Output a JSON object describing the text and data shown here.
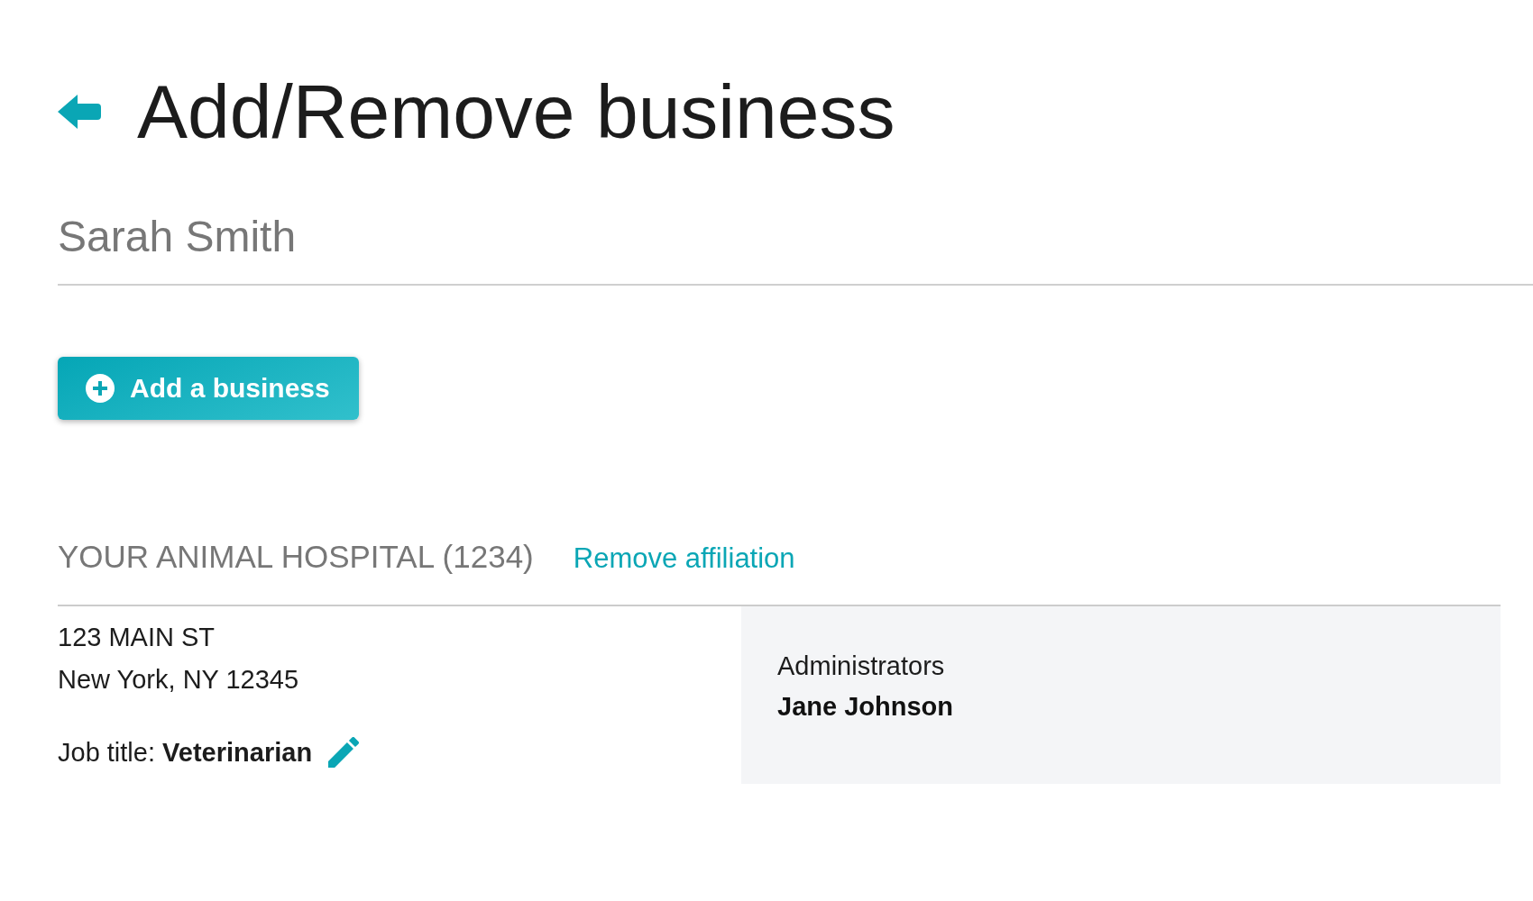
{
  "header": {
    "title": "Add/Remove business"
  },
  "user": {
    "name": "Sarah Smith"
  },
  "add_button": {
    "label": "Add a business"
  },
  "businesses": [
    {
      "name": "YOUR ANIMAL HOSPITAL (1234)",
      "remove_link": "Remove affiliation",
      "address": [
        "123 MAIN ST",
        "New York, NY 12345"
      ],
      "job_title": "Job title: **Veterinarian**",
      "administrators": {
        "label": "Administrators",
        "names": [
          "Jane Johnson"
        ]
      }
    }
  ]
}
